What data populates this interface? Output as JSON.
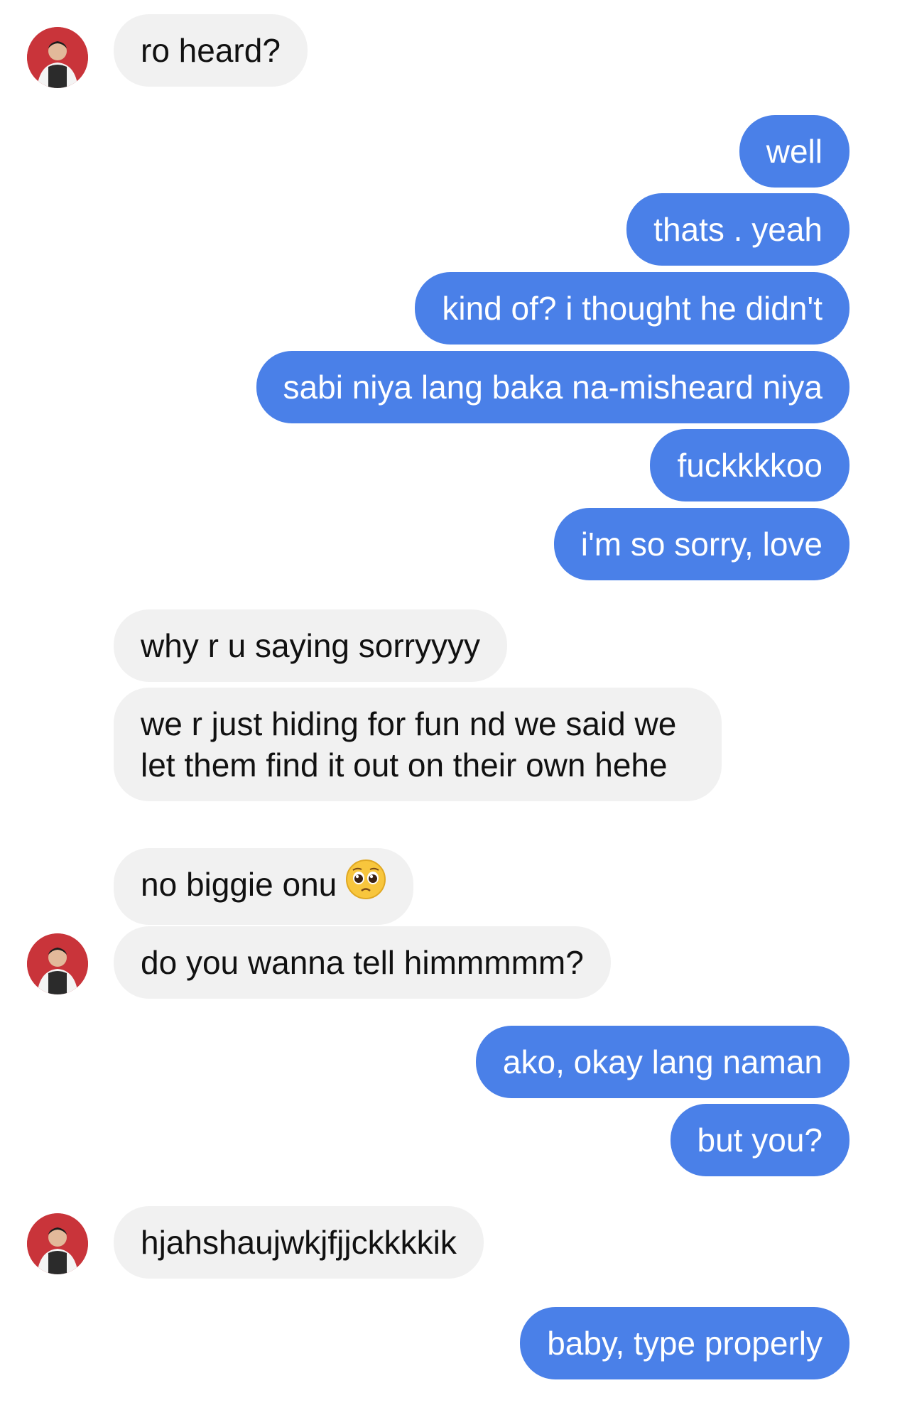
{
  "conversation": {
    "messages": [
      {
        "from": "them",
        "text": "ro heard?"
      },
      {
        "from": "me",
        "text": "well"
      },
      {
        "from": "me",
        "text": "thats . yeah"
      },
      {
        "from": "me",
        "text": "kind of? i thought he didn't"
      },
      {
        "from": "me",
        "text": "sabi niya lang baka na-misheard niya"
      },
      {
        "from": "me",
        "text": "fuckkkkoo"
      },
      {
        "from": "me",
        "text": "i'm so sorry, love"
      },
      {
        "from": "them",
        "text": "why r u saying sorryyyy"
      },
      {
        "from": "them",
        "text": "we r just hiding for fun nd we said we let them find it out on their own hehe"
      },
      {
        "from": "them",
        "text": "no biggie onu",
        "emoji": "pleading-face"
      },
      {
        "from": "them",
        "text": "do you wanna tell himmmmm?"
      },
      {
        "from": "me",
        "text": "ako, okay lang naman"
      },
      {
        "from": "me",
        "text": "but you?"
      },
      {
        "from": "them",
        "text": "hjahshaujwkjfjjckkkkik"
      },
      {
        "from": "me",
        "text": "baby, type properly"
      }
    ]
  },
  "colors": {
    "incoming_bubble": "#f1f1f1",
    "outgoing_bubble": "#4a80e8",
    "avatar_background": "#c9343a"
  }
}
